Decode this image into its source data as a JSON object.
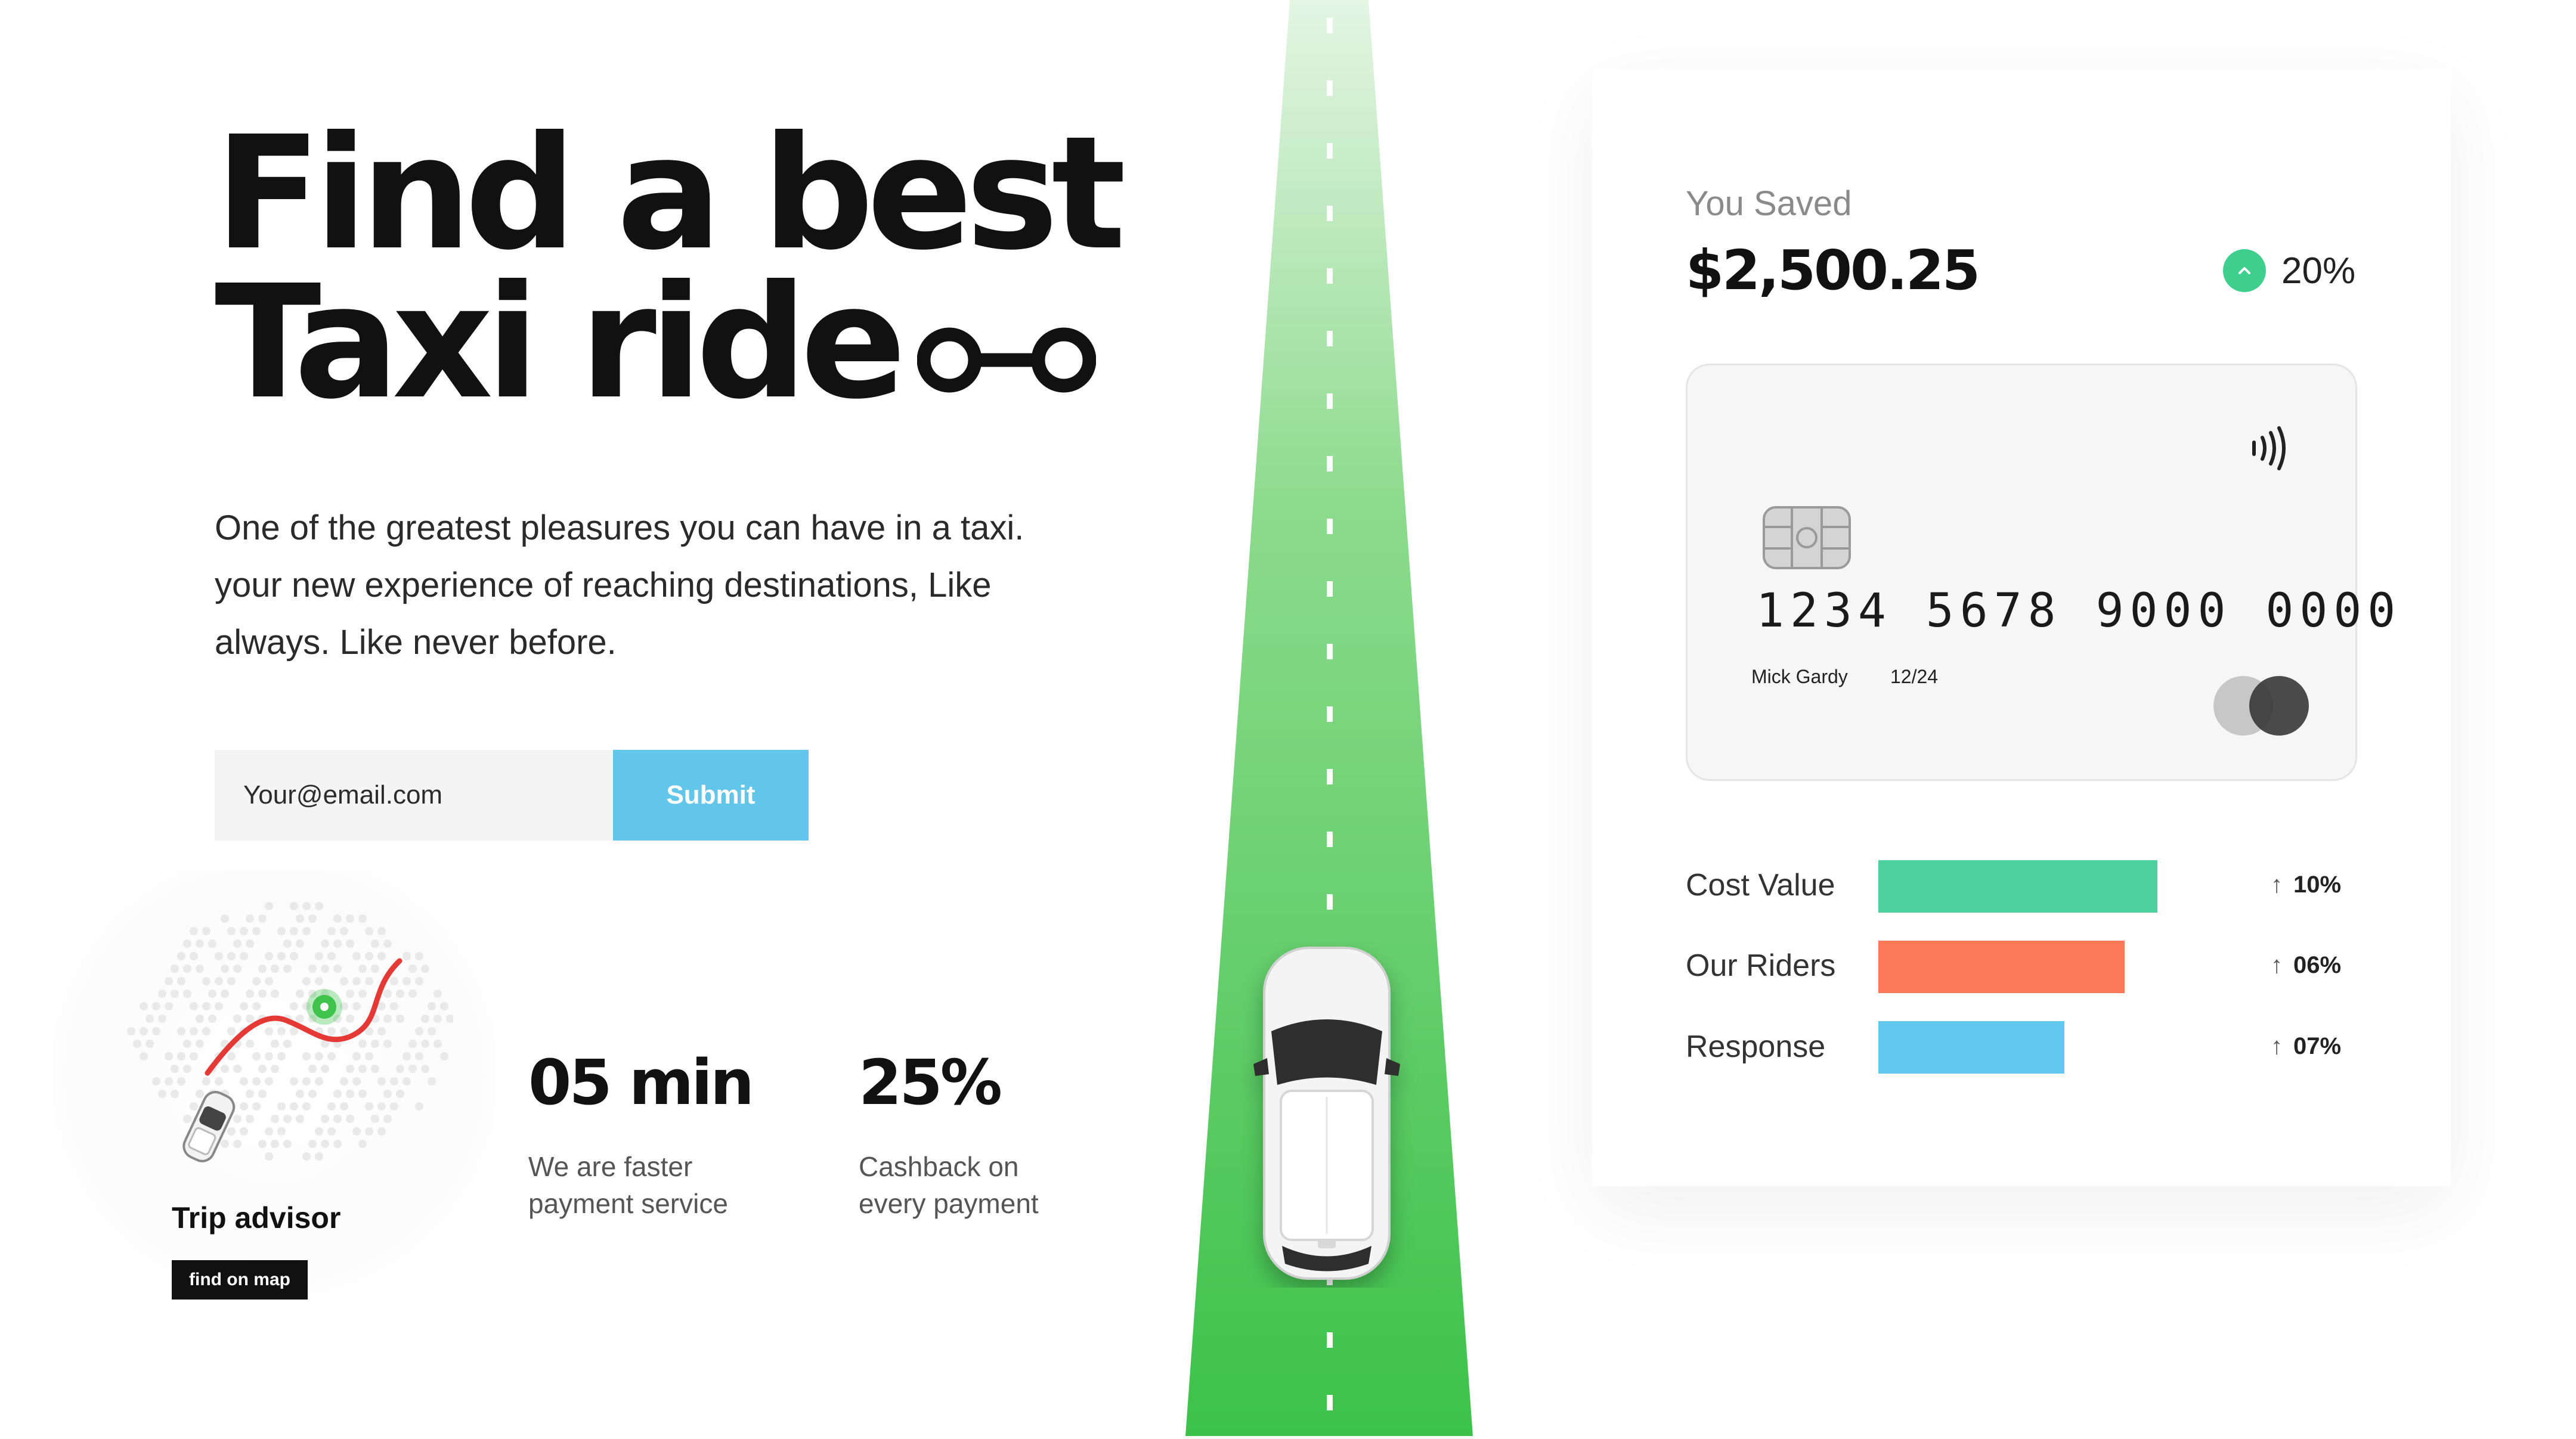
{
  "hero": {
    "title_line1": "Find a best",
    "title_line2": "Taxi ride",
    "route_icon": "route-icon",
    "description": "One of the greatest pleasures you can have in a taxi. your new experience of reaching destinations, Like always. Like never before."
  },
  "signup": {
    "email_placeholder": "Your@email.com",
    "submit_label": "Submit",
    "submit_color": "#62c5ea"
  },
  "trip_advisor": {
    "title": "Trip advisor",
    "button_label": "find on map",
    "icons": [
      "map-icon",
      "location-pin-icon",
      "car-icon"
    ]
  },
  "stats": [
    {
      "value": "05 min",
      "desc_line1": "We are faster",
      "desc_line2": "payment service"
    },
    {
      "value": "25%",
      "desc_line1": "Cashback on",
      "desc_line2": "every payment"
    }
  ],
  "road": {
    "icon": "car-icon",
    "color": "#3fc34c"
  },
  "savings": {
    "label": "You Saved",
    "amount": "$2,500.25",
    "change": "20%",
    "change_icon": "chevron-up-icon",
    "accent": "#3ecf8e"
  },
  "card": {
    "number": "1234  5678  9000  0000",
    "holder": "Mick Gardy",
    "expiry": "12/24",
    "icons": [
      "contactless-icon",
      "chip-icon",
      "mastercard-icon"
    ]
  },
  "metrics": [
    {
      "label": "Cost Value",
      "change": "10%",
      "fraction": 0.6,
      "color": "#4ed19c"
    },
    {
      "label": "Our Riders",
      "change": "06%",
      "fraction": 0.53,
      "color": "#fe7a58"
    },
    {
      "label": "Response",
      "change": "07%",
      "fraction": 0.4,
      "color": "#62c8ee"
    }
  ]
}
